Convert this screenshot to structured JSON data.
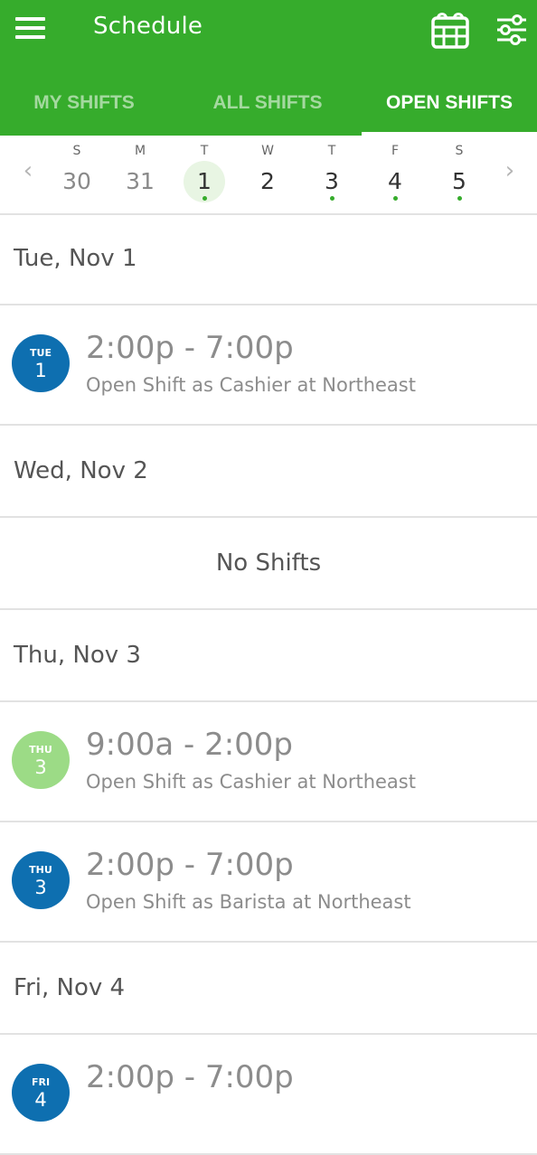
{
  "appbar": {
    "title": "Schedule",
    "icons": {
      "menu": "menu-icon",
      "calendar": "calendar-grid-icon",
      "filter": "filter-sliders-icon"
    },
    "color": "#36ac2c"
  },
  "tabs": [
    {
      "label": "MY SHIFTS",
      "active": false
    },
    {
      "label": "ALL SHIFTS",
      "active": false
    },
    {
      "label": "OPEN SHIFTS",
      "active": true
    }
  ],
  "week": {
    "days": [
      {
        "dow": "S",
        "num": "30",
        "muted": true,
        "selected": false,
        "dot": false
      },
      {
        "dow": "M",
        "num": "31",
        "muted": true,
        "selected": false,
        "dot": false
      },
      {
        "dow": "T",
        "num": "1",
        "muted": false,
        "selected": true,
        "dot": true
      },
      {
        "dow": "W",
        "num": "2",
        "muted": false,
        "selected": false,
        "dot": false
      },
      {
        "dow": "T",
        "num": "3",
        "muted": false,
        "selected": false,
        "dot": true
      },
      {
        "dow": "F",
        "num": "4",
        "muted": false,
        "selected": false,
        "dot": true
      },
      {
        "dow": "S",
        "num": "5",
        "muted": false,
        "selected": false,
        "dot": true
      }
    ],
    "prev_arrow": "‹",
    "next_arrow": "›"
  },
  "sections": [
    {
      "header": "Tue, Nov 1",
      "shifts": [
        {
          "badge_dow": "TUE",
          "badge_num": "1",
          "badge_color": "#0e6fb0",
          "time": "2:00p - 7:00p",
          "desc": "Open Shift as Cashier at Northeast"
        }
      ]
    },
    {
      "header": "Wed, Nov 2",
      "empty_text": "No Shifts"
    },
    {
      "header": "Thu, Nov 3",
      "shifts": [
        {
          "badge_dow": "THU",
          "badge_num": "3",
          "badge_color": "#9cdb86",
          "time": "9:00a - 2:00p",
          "desc": "Open Shift as Cashier at Northeast"
        },
        {
          "badge_dow": "THU",
          "badge_num": "3",
          "badge_color": "#0e6fb0",
          "time": "2:00p - 7:00p",
          "desc": "Open Shift as Barista at Northeast"
        }
      ]
    },
    {
      "header": "Fri, Nov 4",
      "shifts": [
        {
          "badge_dow": "FRI",
          "badge_num": "4",
          "badge_color": "#0e6fb0",
          "time": "2:00p - 7:00p",
          "desc": ""
        }
      ]
    }
  ]
}
